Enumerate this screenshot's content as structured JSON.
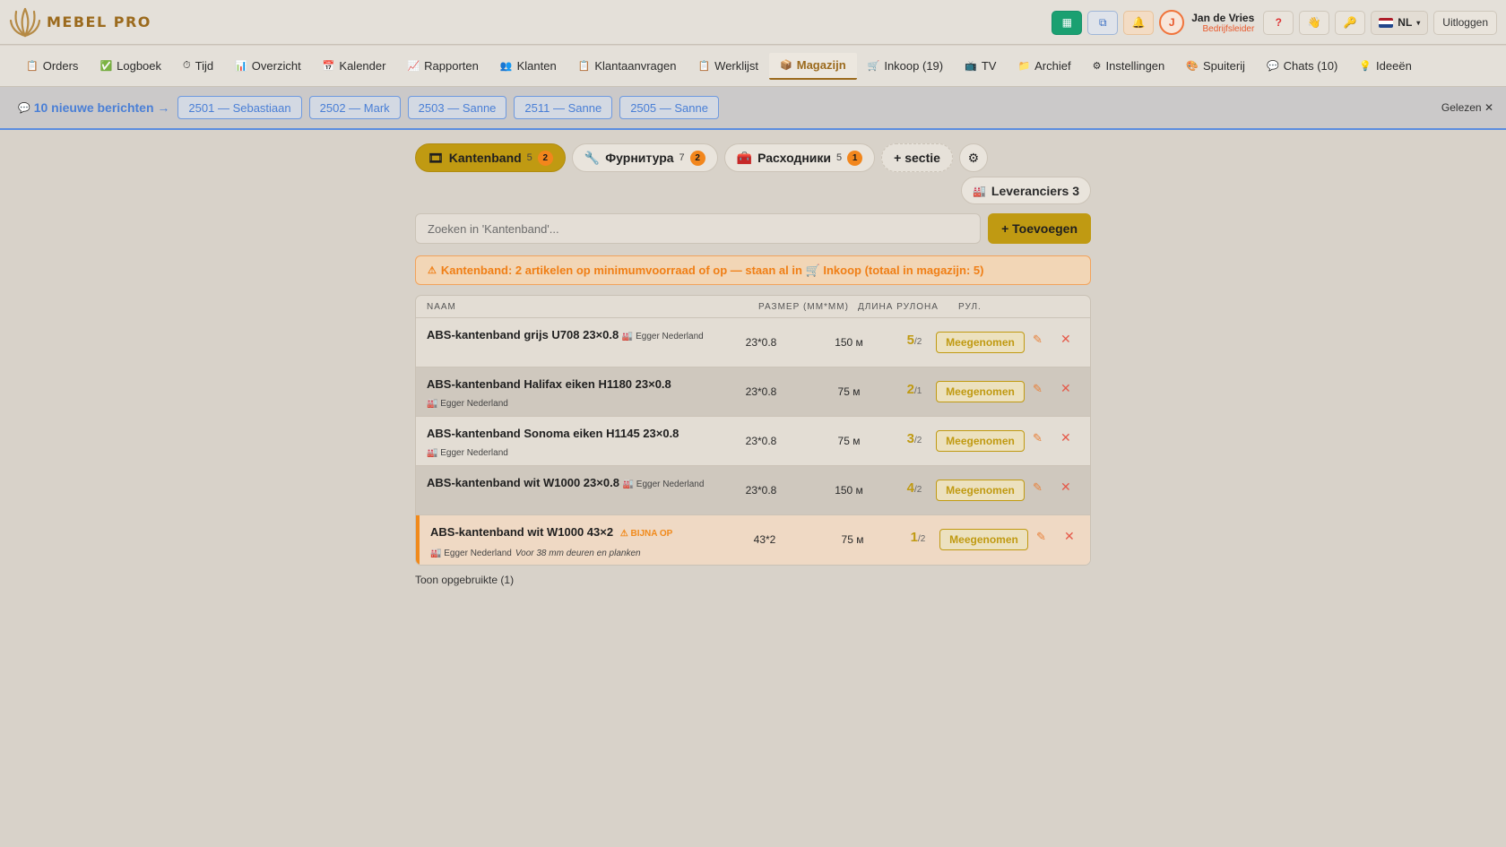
{
  "app": {
    "name": "MEBEL PRO"
  },
  "header": {
    "user_name": "Jan de Vries",
    "user_role": "Bedrijfsleider",
    "avatar_initial": "J",
    "lang": "NL",
    "logout": "Uitloggen",
    "help_label": "?",
    "icons": [
      "grid-add-icon",
      "refresh-icon",
      "bell-icon",
      "help-icon",
      "hand-icon",
      "key-icon"
    ]
  },
  "nav": [
    {
      "label": "Orders",
      "icon": "📋"
    },
    {
      "label": "Logboek",
      "icon": "✅"
    },
    {
      "label": "Tijd",
      "icon": "⏱"
    },
    {
      "label": "Overzicht",
      "icon": "📊"
    },
    {
      "label": "Kalender",
      "icon": "📅"
    },
    {
      "label": "Rapporten",
      "icon": "📈"
    },
    {
      "label": "Klanten",
      "icon": "👥"
    },
    {
      "label": "Klantaanvragen",
      "icon": "📋"
    },
    {
      "label": "Werklijst",
      "icon": "📋"
    },
    {
      "label": "Magazijn",
      "icon": "📦",
      "active": true
    },
    {
      "label": "Inkoop (19)",
      "icon": "🛒"
    },
    {
      "label": "TV",
      "icon": "📺"
    },
    {
      "label": "Archief",
      "icon": "📁"
    },
    {
      "label": "Instellingen",
      "icon": "⚙"
    },
    {
      "label": "Spuiterij",
      "icon": "🎨"
    },
    {
      "label": "Chats (10)",
      "icon": "💬"
    },
    {
      "label": "Ideeën",
      "icon": "💡"
    }
  ],
  "messages": {
    "title": "10 nieuwe berichten →",
    "chips": [
      "2501 — Sebastiaan",
      "2502 — Mark",
      "2503 — Sanne",
      "2511 — Sanne",
      "2505 — Sanne"
    ],
    "read_label": "Gelezen"
  },
  "sections": [
    {
      "label": "Kantenband",
      "count": "5",
      "badge": "2",
      "icon": "🎞",
      "active": true
    },
    {
      "label": "Фурнитура",
      "count": "7",
      "badge": "2",
      "icon": "🔧"
    },
    {
      "label": "Расходники",
      "count": "5",
      "badge": "1",
      "icon": "🧰"
    }
  ],
  "add_section": "+ sectie",
  "suppliers_button": "Leveranciers 3",
  "search": {
    "placeholder": "Zoeken in 'Kantenband'..."
  },
  "add_button": "+ Toevoegen",
  "warning": "Kantenband: 2 artikelen op minimumvoorraad of op — staan al in 🛒 Inkoop (totaal in magazijn: 5)",
  "table": {
    "headers": {
      "name": "NAAM",
      "size": "РАЗМЕР (ММ*ММ)",
      "length": "ДЛИНА РУЛОНА",
      "rolls": "РУЛ."
    },
    "take_label": "Meegenomen",
    "rows": [
      {
        "name": "ABS-kantenband grijs U708 23×0.8",
        "supplier": "Egger Nederland",
        "size": "23*0.8",
        "length": "150 м",
        "rolls": "5",
        "min": "/2"
      },
      {
        "name": "ABS-kantenband Halifax eiken H1180 23×0.8",
        "supplier": "Egger Nederland",
        "size": "23*0.8",
        "length": "75 м",
        "rolls": "2",
        "min": "/1"
      },
      {
        "name": "ABS-kantenband Sonoma eiken H1145 23×0.8",
        "supplier": "Egger Nederland",
        "size": "23*0.8",
        "length": "75 м",
        "rolls": "3",
        "min": "/2"
      },
      {
        "name": "ABS-kantenband wit W1000 23×0.8",
        "supplier": "Egger Nederland",
        "size": "23*0.8",
        "length": "150 м",
        "rolls": "4",
        "min": "/2"
      },
      {
        "name": "ABS-kantenband wit W1000 43×2",
        "tag": "BIJNA OP",
        "supplier": "Egger Nederland",
        "note": "Voor 38 mm deuren en planken",
        "size": "43*2",
        "length": "75 м",
        "rolls": "1",
        "min": "/2",
        "low": true
      }
    ]
  },
  "show_used": "Toon opgebruikte (1)",
  "colors": {
    "accent": "#c09a12",
    "brand": "#9b6a1d",
    "warning": "#f07f16",
    "link": "#4a7fd6"
  }
}
